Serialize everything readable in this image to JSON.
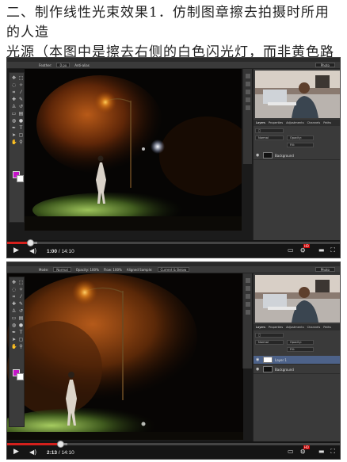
{
  "caption": {
    "line1": "二、制作线性光束效果1．仿制图章擦去拍摄时所用的人造",
    "line2": "光源（本图中是擦去右侧的白色闪光灯，而非黄色路灯"
  },
  "frames": [
    {
      "options": {
        "label1": "Feather:",
        "value1": "0 px",
        "label2": "Anti-alias"
      },
      "preset": "Photo",
      "panel_tabs": [
        "Layers",
        "Properties",
        "Adjustments",
        "Channels",
        "Paths"
      ],
      "blend_mode": "Normal",
      "opacity_label": "Opacity:",
      "fill_label": "Fill:",
      "layers": [
        {
          "name": "Background",
          "selected": false
        }
      ],
      "time": {
        "current": "1:00",
        "total": "14:10"
      },
      "progress": 0.07,
      "buffered": 0.09
    },
    {
      "options": {
        "label1": "Mode:",
        "value1": "Normal",
        "label2": "Opacity: 100%",
        "label3": "Flow: 100%",
        "label4": "Aligned Sample:",
        "value4": "Current & Below"
      },
      "preset": "Photo",
      "panel_tabs": [
        "Layers",
        "Properties",
        "Adjustments",
        "Channels",
        "Paths"
      ],
      "blend_mode": "Normal",
      "opacity_label": "Opacity:",
      "fill_label": "Fill:",
      "layers": [
        {
          "name": "Layer 1",
          "selected": true
        },
        {
          "name": "Background",
          "selected": false
        }
      ],
      "time": {
        "current": "2:13",
        "total": "14:10"
      },
      "progress": 0.16,
      "buffered": 0.18
    }
  ],
  "colors": {
    "foreground": "#c414c8",
    "background": "#ffffff",
    "progress": "#d4201c"
  },
  "icons": [
    "play-icon",
    "volume-icon",
    "settings-icon",
    "hd-badge",
    "theater-icon",
    "fullscreen-icon"
  ]
}
